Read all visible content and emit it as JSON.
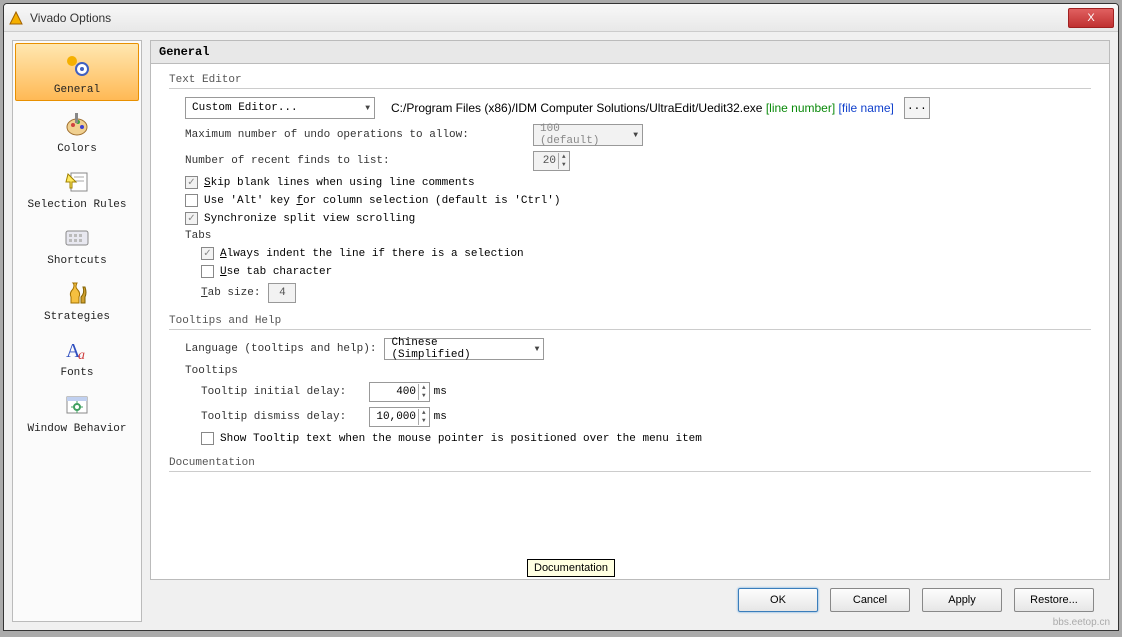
{
  "window": {
    "title": "Vivado Options",
    "close": "X"
  },
  "sidebar": [
    {
      "key": "general",
      "label": "General",
      "selected": true
    },
    {
      "key": "colors",
      "label": "Colors"
    },
    {
      "key": "selrules",
      "label": "Selection Rules"
    },
    {
      "key": "shortcuts",
      "label": "Shortcuts"
    },
    {
      "key": "strategies",
      "label": "Strategies"
    },
    {
      "key": "fonts",
      "label": "Fonts"
    },
    {
      "key": "winbehav",
      "label": "Window Behavior"
    }
  ],
  "main": {
    "heading": "General",
    "text_editor": {
      "title": "Text Editor",
      "editor_dropdown": "Custom Editor...",
      "editor_path": "C:/Program Files (x86)/IDM Computer Solutions/UltraEdit/Uedit32.exe",
      "line_number_token": "[line number]",
      "file_name_token": "[file name]",
      "browse": "...",
      "max_undo_label": "Maximum number of undo operations to allow:",
      "max_undo_value": "100 (default)",
      "recent_finds_label": "Number of recent finds to list:",
      "recent_finds_value": "20",
      "skip_blank_label": "Skip blank lines when using line comments",
      "skip_blank_letter": "S",
      "alt_key_label_pre": "Use 'Alt' key ",
      "alt_key_letter": "f",
      "alt_key_label_post": "or column selection (default is 'Ctrl')",
      "sync_split_label": "Synchronize split view scrolling",
      "tabs_title": "Tabs",
      "always_indent_letter": "A",
      "always_indent_label": "lways indent the line if there is a selection",
      "use_tab_char_letter": "U",
      "use_tab_char_label": "se tab character",
      "tab_size_label_letter": "T",
      "tab_size_label": "ab size:",
      "tab_size_value": "4"
    },
    "tooltips": {
      "title": "Tooltips and Help",
      "lang_label": "Language (tooltips and help):",
      "lang_value": "Chinese (Simplified)",
      "sub_title": "Tooltips",
      "init_delay_label": "Tooltip initial delay:",
      "init_delay_value": "400",
      "dismiss_delay_label": "Tooltip dismiss delay:",
      "dismiss_delay_value": "10,000",
      "ms": "ms",
      "show_tooltip_label": "Show Tooltip text when the mouse pointer is positioned over the menu item"
    },
    "documentation": {
      "title": "Documentation",
      "tooltip": "Documentation"
    }
  },
  "buttons": {
    "ok": "OK",
    "cancel": "Cancel",
    "apply": "Apply",
    "restore": "Restore..."
  },
  "watermark": "bbs.eetop.cn"
}
